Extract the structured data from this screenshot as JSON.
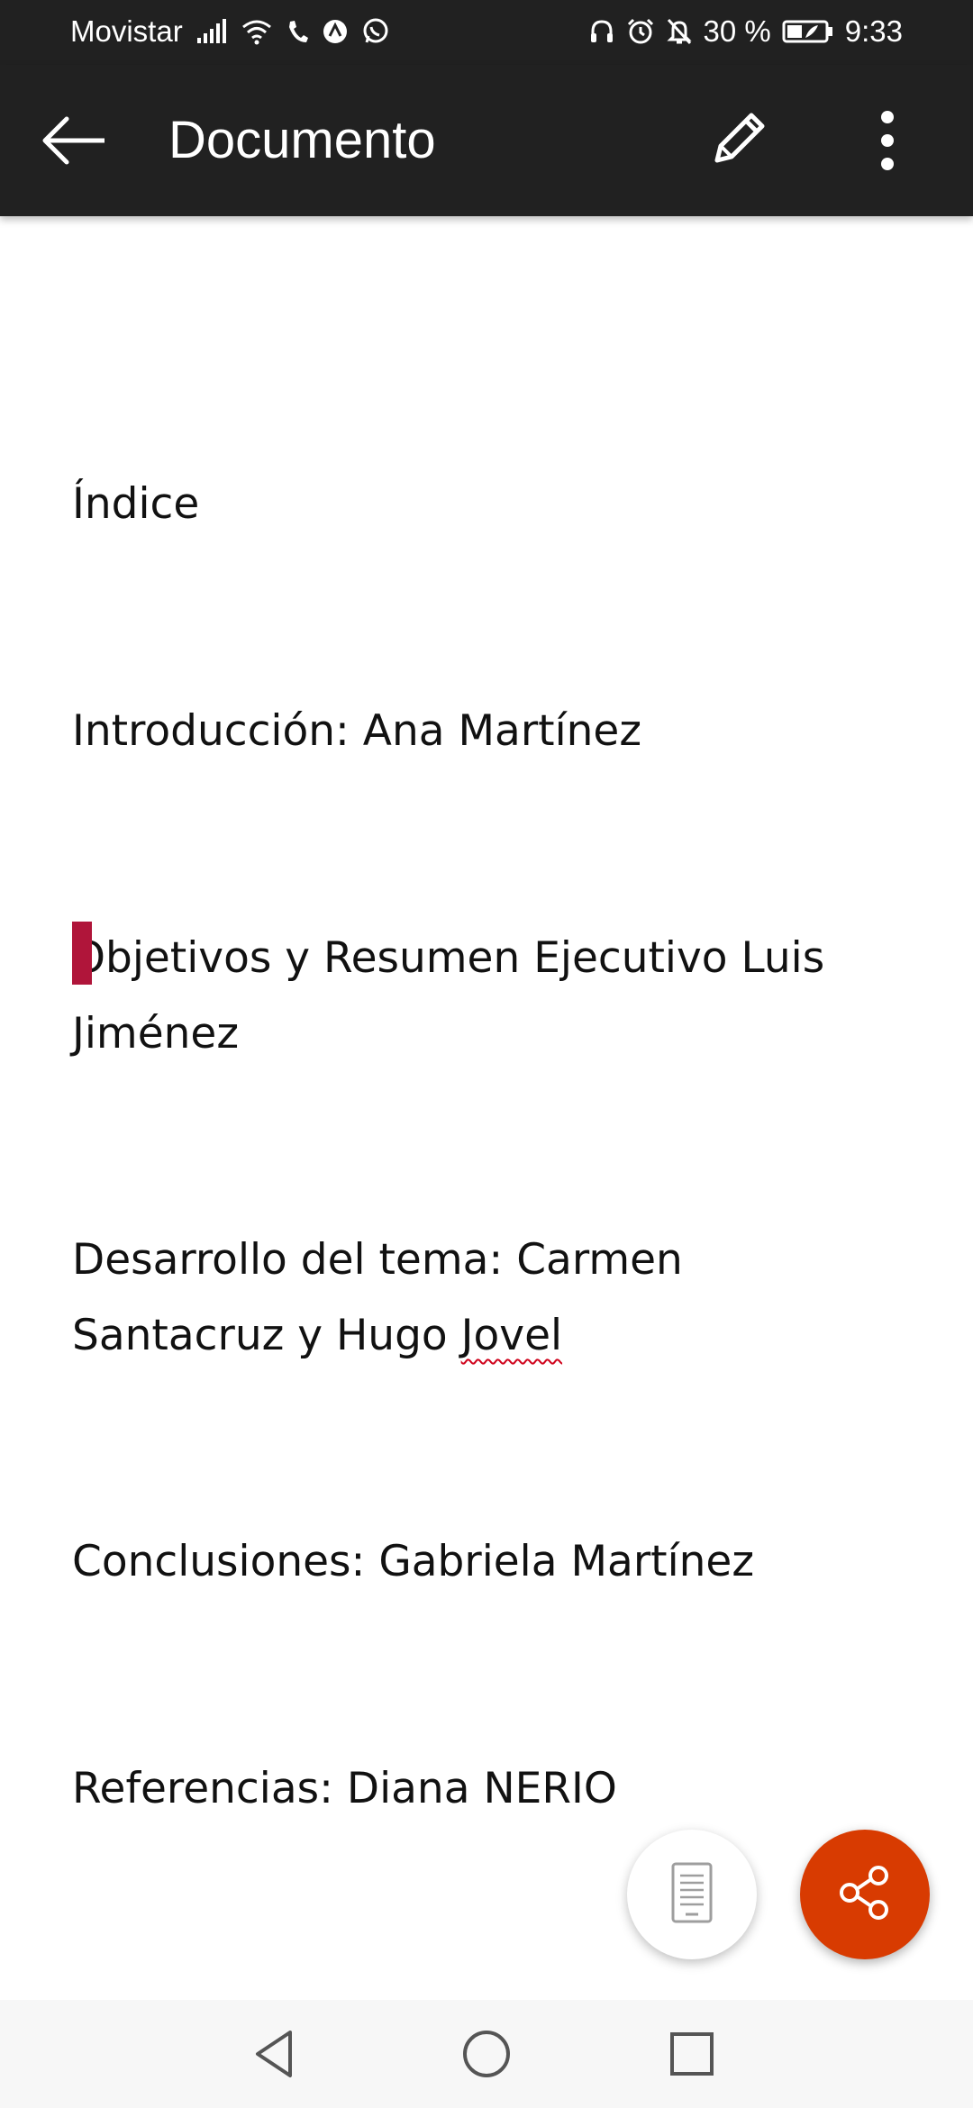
{
  "status_bar": {
    "carrier": "Movistar",
    "battery": "30 %",
    "time": "9:33",
    "icons": [
      "signal-icon",
      "wifi-icon",
      "phone-icon",
      "app-icon",
      "whatsapp-icon",
      "headset-icon",
      "alarm-icon",
      "notifications-off-icon",
      "battery-icon"
    ]
  },
  "app_bar": {
    "title": "Documento",
    "icons": [
      "back-arrow-icon",
      "pencil-icon",
      "more-vert-icon"
    ]
  },
  "document": {
    "paragraphs": [
      "Índice",
      "Introducción: Ana Martínez",
      "Objetivos y Resumen Ejecutivo Luis Jiménez",
      "Desarrollo del tema: Carmen Santacruz y Hugo Jovel",
      "Conclusiones: Gabriela Martínez",
      "Referencias: Diana NERIO"
    ],
    "desarrollo_prefix": "Desarrollo del tema: Carmen Santacruz y Hugo ",
    "desarrollo_flagged": "Jovel"
  },
  "fabs": {
    "reading_icon": "mobile-view-icon",
    "share_icon": "share-icon",
    "share_color": "#d83b01"
  },
  "nav_bar": {
    "icons": [
      "back-triangle-icon",
      "home-circle-icon",
      "recents-square-icon"
    ]
  }
}
